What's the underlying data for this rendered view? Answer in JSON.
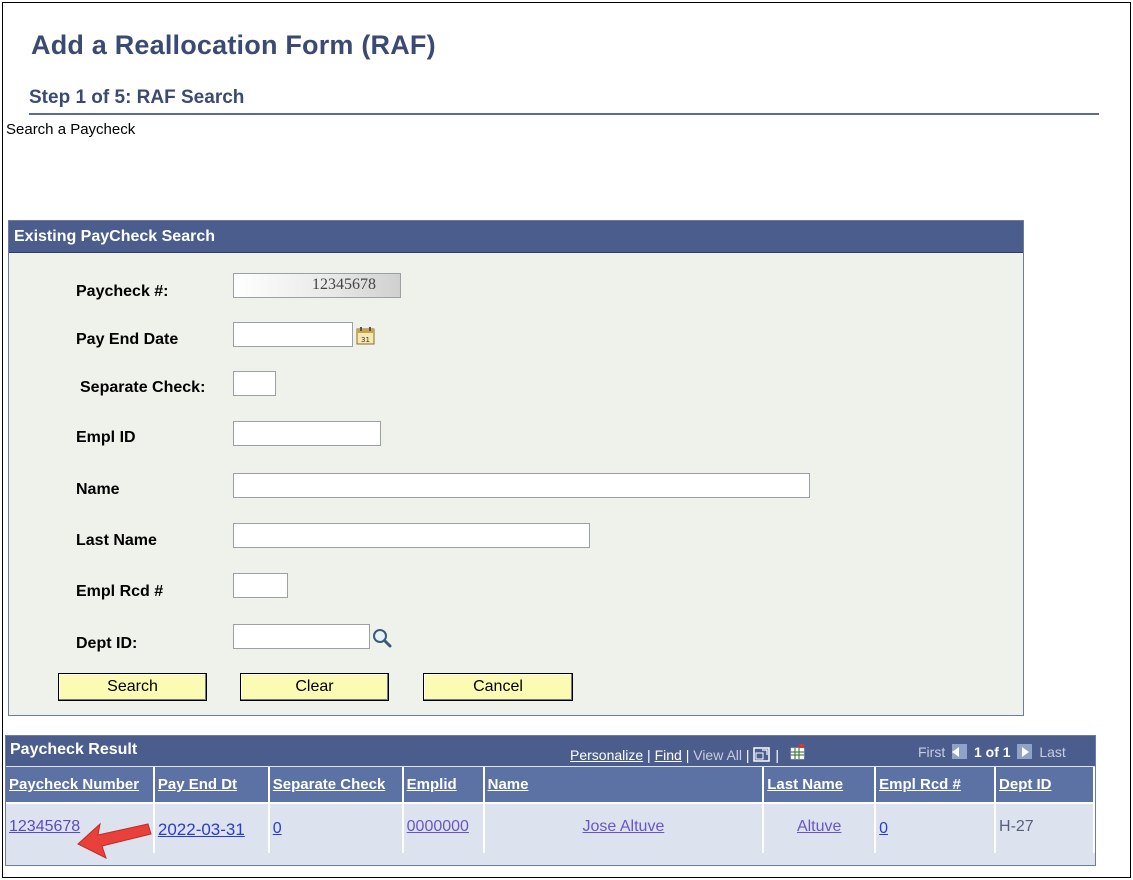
{
  "page": {
    "title": "Add a Reallocation Form (RAF)",
    "step": "Step 1 of 5: RAF Search",
    "subtitle": "Search a Paycheck"
  },
  "search": {
    "header": "Existing PayCheck Search",
    "fields": {
      "paycheck": {
        "label": "Paycheck #:",
        "value": "12345678"
      },
      "pay_end_date": {
        "label": "Pay End Date",
        "value": ""
      },
      "separate_check": {
        "label": "Separate Check:",
        "value": ""
      },
      "empl_id": {
        "label": "Empl ID",
        "value": ""
      },
      "name": {
        "label": "Name",
        "value": ""
      },
      "last_name": {
        "label": "Last Name",
        "value": ""
      },
      "empl_rcd": {
        "label": "Empl Rcd #",
        "value": ""
      },
      "dept_id": {
        "label": "Dept ID:",
        "value": ""
      }
    },
    "buttons": {
      "search": "Search",
      "clear": "Clear",
      "cancel": "Cancel"
    }
  },
  "result": {
    "header": "Paycheck Result",
    "links": {
      "personalize": "Personalize",
      "find": "Find",
      "view_all": "View All",
      "sep": "|"
    },
    "nav": {
      "first": "First",
      "count": "1 of 1",
      "last": "Last"
    },
    "columns": [
      "Paycheck Number",
      "Pay End Dt",
      "Separate Check",
      "Emplid",
      "Name",
      "Last Name",
      "Empl Rcd #",
      "Dept ID"
    ],
    "rows": [
      [
        "12345678",
        "2022-03-31",
        "0",
        "0000000",
        "Jose Altuve",
        "Altuve",
        "0",
        "H-27"
      ]
    ]
  },
  "colors": {
    "title": "#3a4a73",
    "header_bg": "#4a5d8c",
    "button_bg": "#fbfbb3",
    "link": "#2a3bd0",
    "arrow": "#e8403a"
  },
  "icons": [
    "calendar-icon",
    "lookup-magnifier-icon",
    "zoom-grid-icon",
    "download-excel-icon",
    "first-arrow-icon",
    "last-arrow-icon",
    "annotation-arrow"
  ]
}
